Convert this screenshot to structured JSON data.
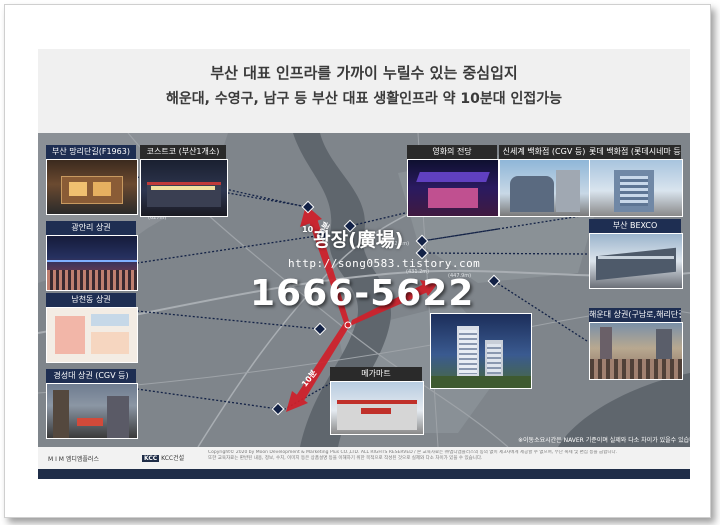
{
  "headline": {
    "line1": "부산 대표 인프라를 가까이 누릴수 있는 중심입지",
    "line2": "해운대, 수영구, 남구 등 부산 대표 생활인프라 약 10분대 인접가능"
  },
  "places_left": [
    {
      "label": "부산 망리단길(F1963)"
    },
    {
      "label": "광안리 상권"
    },
    {
      "label": "남천동 상권"
    },
    {
      "label": "경성대 상권 (CGV 등)"
    }
  ],
  "place_costco": {
    "label": "코스트코 (부산1개소)"
  },
  "place_mega": {
    "label": "메가마트"
  },
  "places_right_top": [
    {
      "label": "영화의 전당"
    },
    {
      "label": "신세계 백화점 (CGV 등)"
    },
    {
      "label": "롯데 백화점 (롯데시네마 등)"
    }
  ],
  "places_right": [
    {
      "label": "부산 BEXCO"
    },
    {
      "label": "해운대 상권(구남로,해리단길)"
    }
  ],
  "watermark": {
    "name_super": "10",
    "name": "광장(廣場)",
    "url": "http://song0583.tistory.com",
    "phone": "1666-5622"
  },
  "time_badges": {
    "top": "10분",
    "bottom": "10분"
  },
  "disclaimer": "※이동소요시간은 NAVER 기준이며 실제와 다소 차이가 있을수 있습니다.",
  "footer": {
    "logo_mim": "M I M 엠디엠플러스",
    "logo_kcc_box": "KCC",
    "logo_kcc": "KCC건설",
    "copyright_line1": "Copyright© 2020 by Moon Development & Marketing Plus CO.,LTD. ALL RIGHTS RESERVED / 본 교육자료는 ㈜엠디엠플러스의 동의 없이 제3자에게 제공할 수 없으며, 무단 복제 및 편집 등을 금합니다.",
    "copyright_line2": "또한 교육자료는 판반된 내용, 정보, 수치, 이미지 등은 상품설명 등을 이해하기 위한 목적으로 작성된 것으로 실제와 다소 차이가 있을 수 있습니다."
  },
  "colors": {
    "label_navy": "#1e2e52",
    "bottom_bar": "#1f2d48",
    "arrow_red": "#d0202a",
    "map_gray": "#7f858b"
  }
}
